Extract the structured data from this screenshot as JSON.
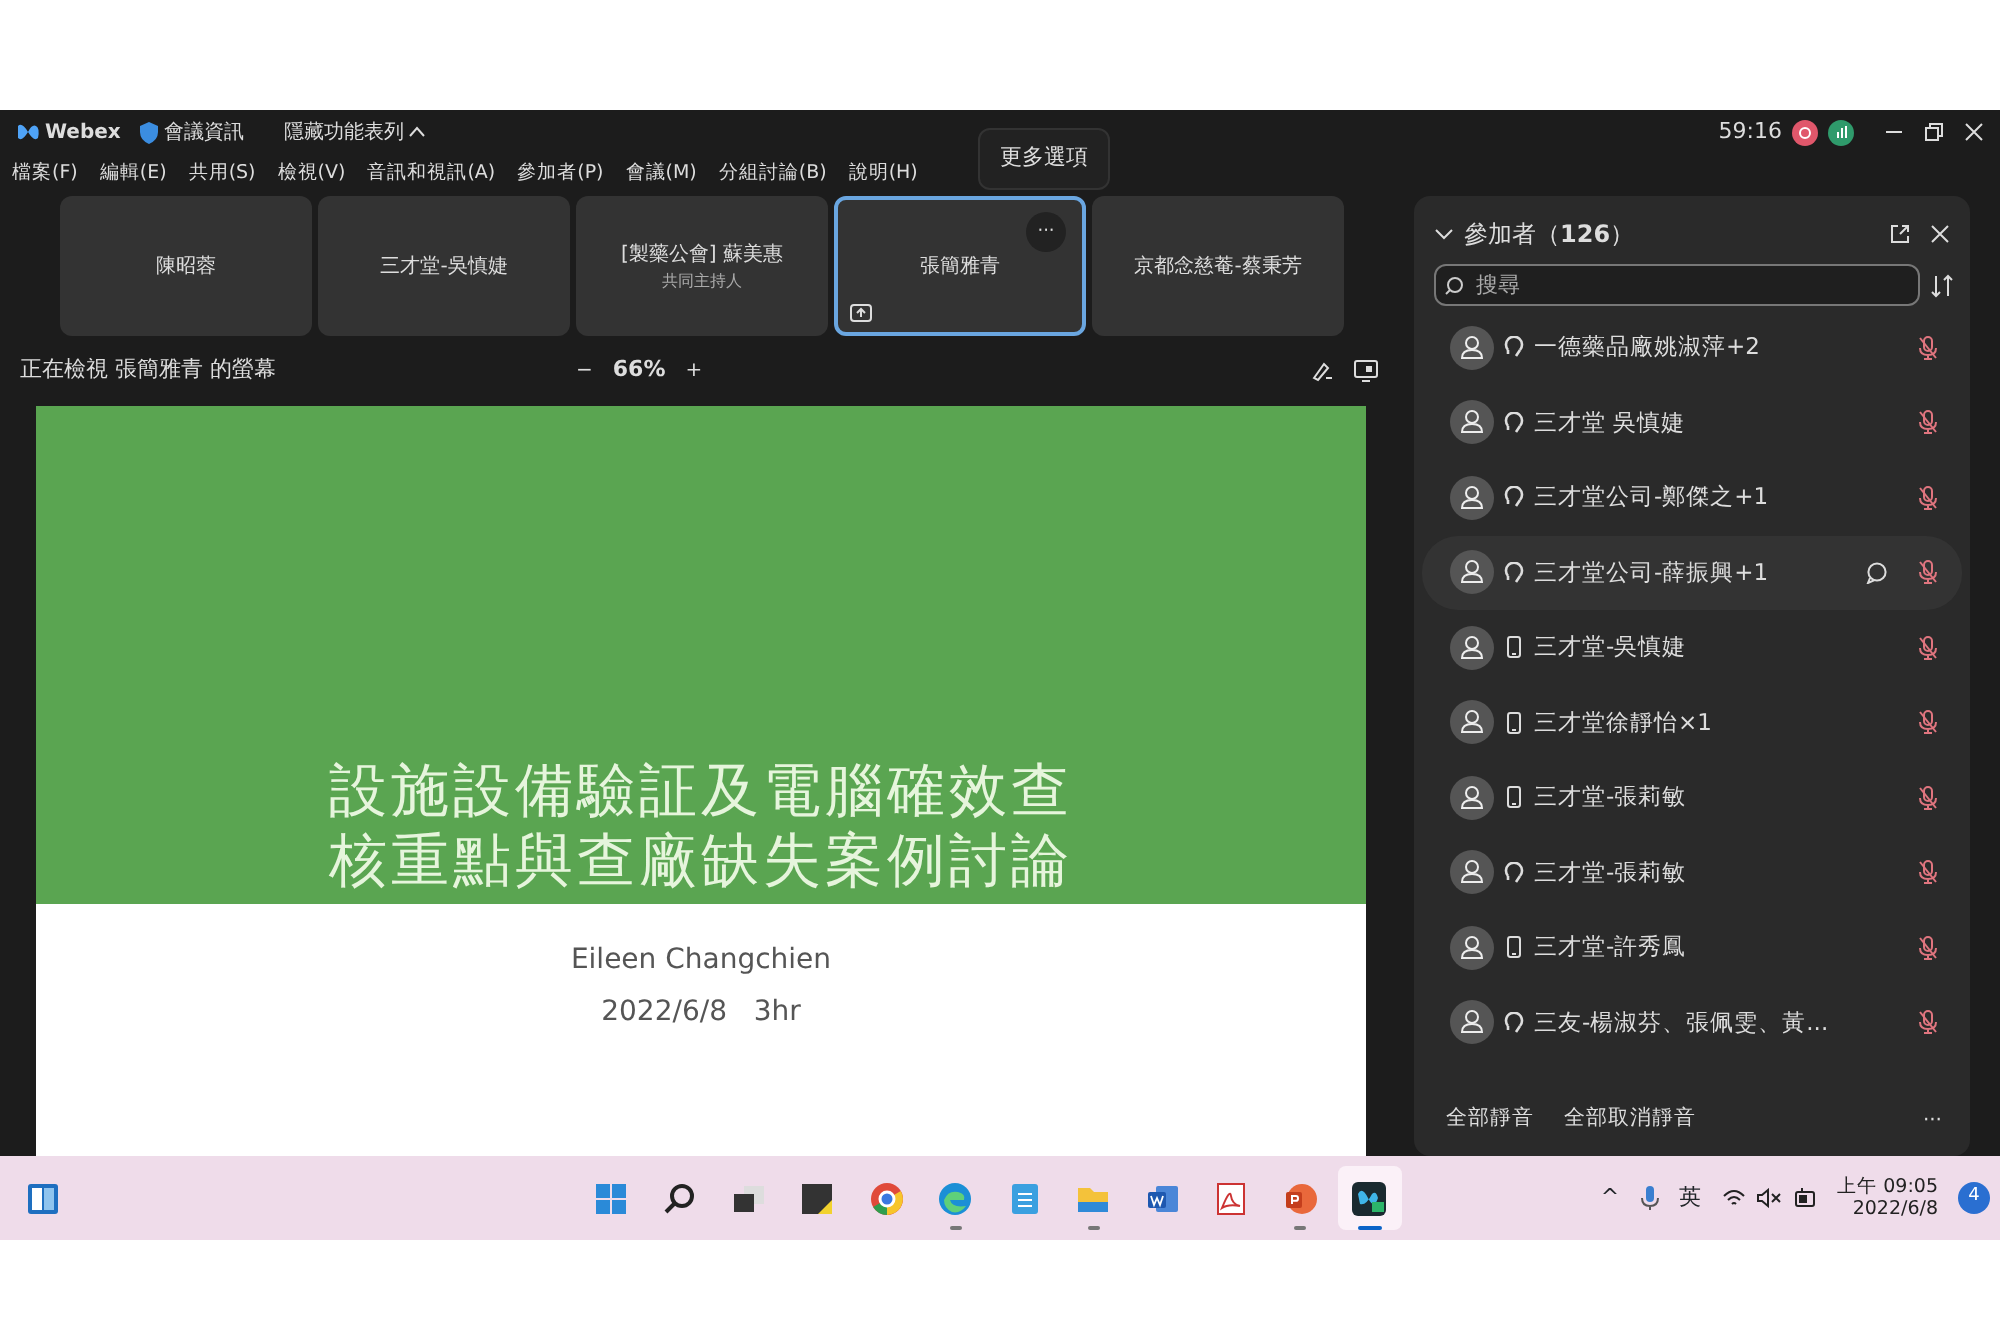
{
  "window": {
    "app_name": "Webex",
    "meeting_info": "會議資訊",
    "hide_menu": "隱藏功能表列",
    "timer": "59:16"
  },
  "menu": [
    "檔案(F)",
    "編輯(E)",
    "共用(S)",
    "檢視(V)",
    "音訊和視訊(A)",
    "參加者(P)",
    "會議(M)",
    "分組討論(B)",
    "說明(H)"
  ],
  "tiles": [
    {
      "name": "陳昭蓉",
      "selected": false
    },
    {
      "name": "三才堂-吳慎婕",
      "selected": false
    },
    {
      "name": "[製藥公會] 蘇美惠",
      "subtitle": "共同主持人",
      "selected": false
    },
    {
      "name": "張簡雅青",
      "selected": true,
      "more": "···",
      "tooltip": "更多選項"
    },
    {
      "name": "京都念慈菴-蔡秉芳",
      "selected": false
    }
  ],
  "view_bar": {
    "label": "正在檢視 張簡雅青 的螢幕",
    "minus": "−",
    "zoom": "66%",
    "plus": "+"
  },
  "slide": {
    "title_lines": [
      "設施設備驗証及電腦確效查",
      "核重點與查廠缺失案例討論"
    ],
    "presenter": "Eileen Changchien",
    "date": "2022/6/8   3hr"
  },
  "participants": {
    "title": "參加者（**126**）",
    "search": {
      "placeholder": "搜尋"
    },
    "rows": [
      {
        "name": "一德藥品廠姚淑萍+2",
        "kind": "headset",
        "muted": true,
        "hovered": false
      },
      {
        "name": "三才堂 吳慎婕",
        "kind": "headset",
        "muted": true,
        "hovered": false
      },
      {
        "name": "三才堂公司-鄭傑之+1",
        "kind": "headset",
        "muted": true,
        "hovered": false
      },
      {
        "name": "三才堂公司-薛振興+1",
        "kind": "headset",
        "muted": true,
        "hovered": true
      },
      {
        "name": "三才堂-吳慎婕",
        "kind": "phone",
        "muted": true,
        "hovered": false
      },
      {
        "name": "三才堂徐靜怡×1",
        "kind": "phone",
        "muted": true,
        "hovered": false
      },
      {
        "name": "三才堂-張莉敏",
        "kind": "phone",
        "muted": true,
        "hovered": false
      },
      {
        "name": "三才堂-張莉敏",
        "kind": "headset",
        "muted": true,
        "hovered": false
      },
      {
        "name": "三才堂-許秀鳳",
        "kind": "phone",
        "muted": true,
        "hovered": false
      },
      {
        "name": "三友-楊淑芬、張佩雯、黃...",
        "kind": "headset",
        "muted": true,
        "hovered": false
      }
    ],
    "mute_all": "全部靜音",
    "unmute_all": "全部取消靜音",
    "more": "···"
  },
  "taskbar": {
    "apps": [
      {
        "kind": "start",
        "running": false,
        "active": false
      },
      {
        "kind": "search",
        "running": false,
        "active": false
      },
      {
        "kind": "taskview",
        "running": false,
        "active": false
      },
      {
        "kind": "sticky",
        "running": false,
        "active": false
      },
      {
        "kind": "chrome",
        "running": false,
        "active": false
      },
      {
        "kind": "edge",
        "running": true,
        "active": false
      },
      {
        "kind": "notepad",
        "running": false,
        "active": false
      },
      {
        "kind": "files",
        "running": true,
        "active": false
      },
      {
        "kind": "word",
        "running": false,
        "active": false
      },
      {
        "kind": "pdf",
        "running": false,
        "active": false
      },
      {
        "kind": "powerpoint",
        "running": true,
        "active": false
      },
      {
        "kind": "webex",
        "running": true,
        "active": true
      }
    ],
    "chevron": "^",
    "ime": "英",
    "time": "上午 09:05",
    "date": "2022/6/8",
    "notifications": "4"
  }
}
